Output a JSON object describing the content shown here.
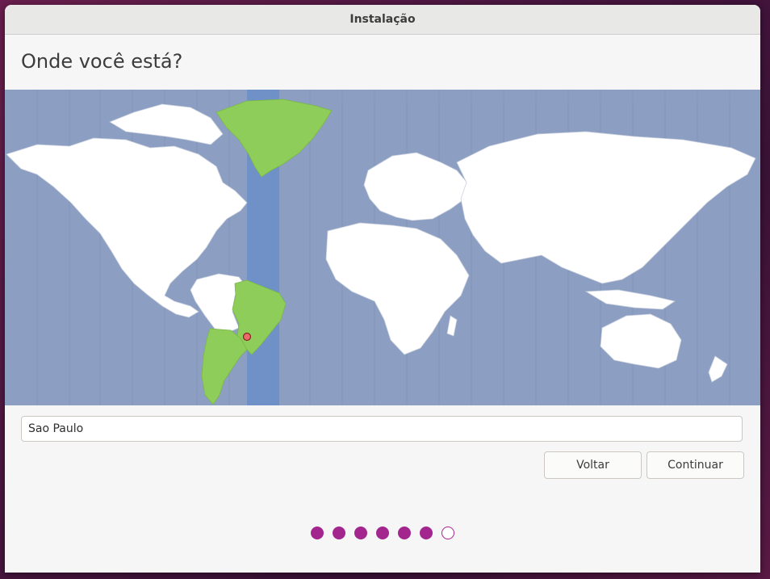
{
  "window": {
    "title": "Instalação"
  },
  "page": {
    "heading": "Onde você está?"
  },
  "location": {
    "value": "Sao Paulo"
  },
  "buttons": {
    "back": "Voltar",
    "continue": "Continuar"
  },
  "progress": {
    "total_steps": 7,
    "completed_steps": 6
  },
  "colors": {
    "ocean": "#8c9fc2",
    "land": "#ffffff",
    "selected_region": "#8ecd59",
    "selected_timezone_band": "#6f91c8",
    "accent": "#a3268e"
  }
}
